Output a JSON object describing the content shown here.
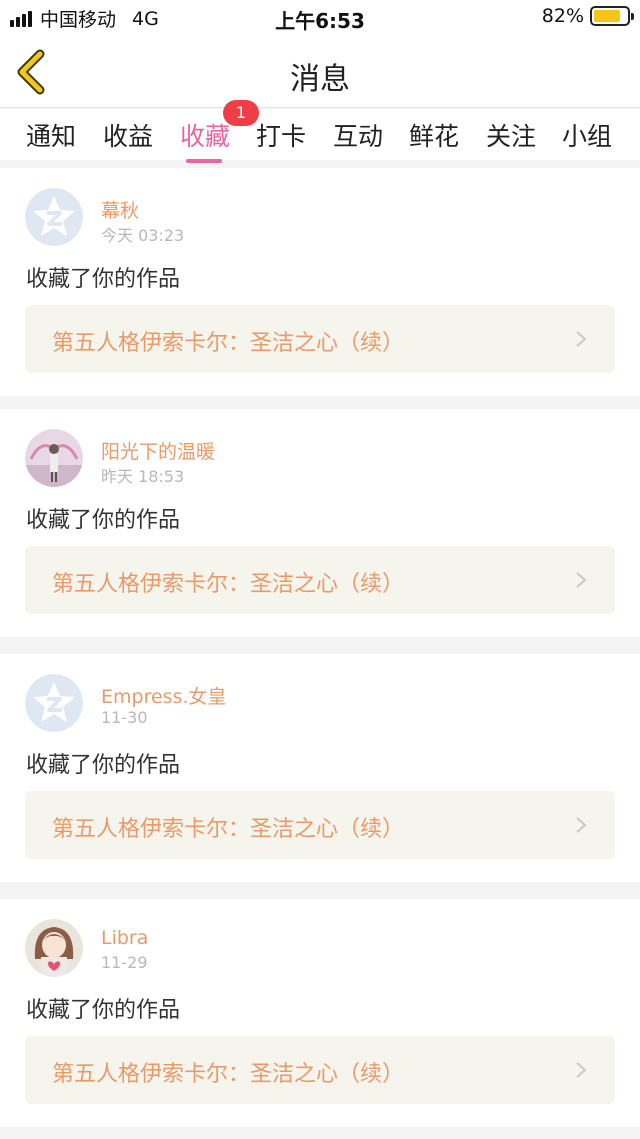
{
  "status_bar": {
    "carrier": "中国移动",
    "network": "4G",
    "time": "上午6:53",
    "battery": "82%"
  },
  "nav": {
    "title": "消息",
    "back_icon": "chevron-left-icon"
  },
  "tabs": [
    {
      "label": "通知"
    },
    {
      "label": "收益"
    },
    {
      "label": "收藏",
      "active": true,
      "badge": "1"
    },
    {
      "label": "打卡"
    },
    {
      "label": "互动"
    },
    {
      "label": "鲜花"
    },
    {
      "label": "关注"
    },
    {
      "label": "小组"
    }
  ],
  "messages": [
    {
      "user": "幕秋",
      "time": "今天 03:23",
      "action": "收藏了你的作品",
      "work": "第五人格伊索卡尔：圣洁之心（续）",
      "avatar": "default-avatar"
    },
    {
      "user": "阳光下的温暖",
      "time": "昨天 18:53",
      "action": "收藏了你的作品",
      "work": "第五人格伊索卡尔：圣洁之心（续）",
      "avatar": "photo-avatar"
    },
    {
      "user": "Empress.女皇",
      "time": "11-30",
      "action": "收藏了你的作品",
      "work": "第五人格伊索卡尔：圣洁之心（续）",
      "avatar": "default-avatar"
    },
    {
      "user": "Libra",
      "time": "11-29",
      "action": "收藏了你的作品",
      "work": "第五人格伊索卡尔：圣洁之心（续）",
      "avatar": "cartoon-girl-avatar"
    }
  ],
  "colors": {
    "accent": "#e5679f",
    "username": "#e99a68",
    "badge": "#ee3f49",
    "work_box_bg": "#f5f5ee",
    "back_icon": "#f2c81c"
  }
}
